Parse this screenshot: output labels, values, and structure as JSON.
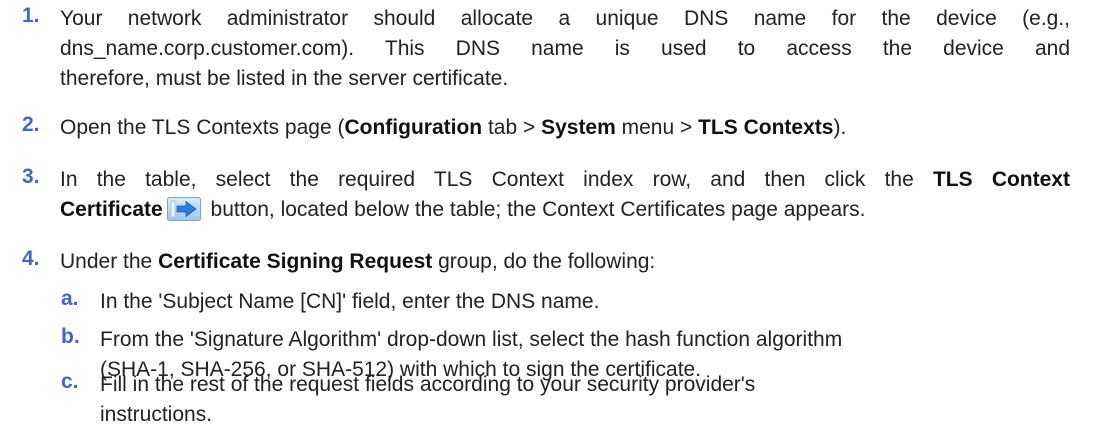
{
  "steps": [
    {
      "number": "1.",
      "lines": [
        "Your network administrator should allocate a unique DNS name for the device (e.g.,",
        "dns_name.corp.customer.com). This DNS name is used to access the device and",
        "therefore, must be listed in the server certificate."
      ]
    },
    {
      "number": "2.",
      "pre": "Open the TLS Contexts page (",
      "b1": "Configuration",
      "mid1": " tab > ",
      "b2": "System",
      "mid2": " menu > ",
      "b3": "TLS Contexts",
      "post": ")."
    },
    {
      "number": "3.",
      "pre": "In the table, select the required TLS Context index row, and then click the ",
      "b1": "TLS Context",
      "b2": "Certificate",
      "post": " button, located below the table; the Context Certificates page appears.",
      "icon": "arrow-right-button-icon"
    },
    {
      "number": "4.",
      "pre": "Under the ",
      "b1": "Certificate Signing Request",
      "post": " group, do the following:"
    }
  ],
  "substeps": [
    {
      "letter": "a.",
      "lines": [
        "In the 'Subject Name [CN]' field, enter the DNS name."
      ]
    },
    {
      "letter": "b.",
      "lines": [
        "From the 'Signature Algorithm' drop-down list, select the hash function algorithm",
        "(SHA-1, SHA-256, or SHA-512) with which to sign the certificate."
      ]
    },
    {
      "letter": "c.",
      "lines": [
        "Fill in the rest of the request fields according to your security provider's",
        "instructions."
      ]
    }
  ],
  "colors": {
    "number": "#3f68c4",
    "text": "#222222",
    "icon_bg": "#4a8fe0"
  }
}
